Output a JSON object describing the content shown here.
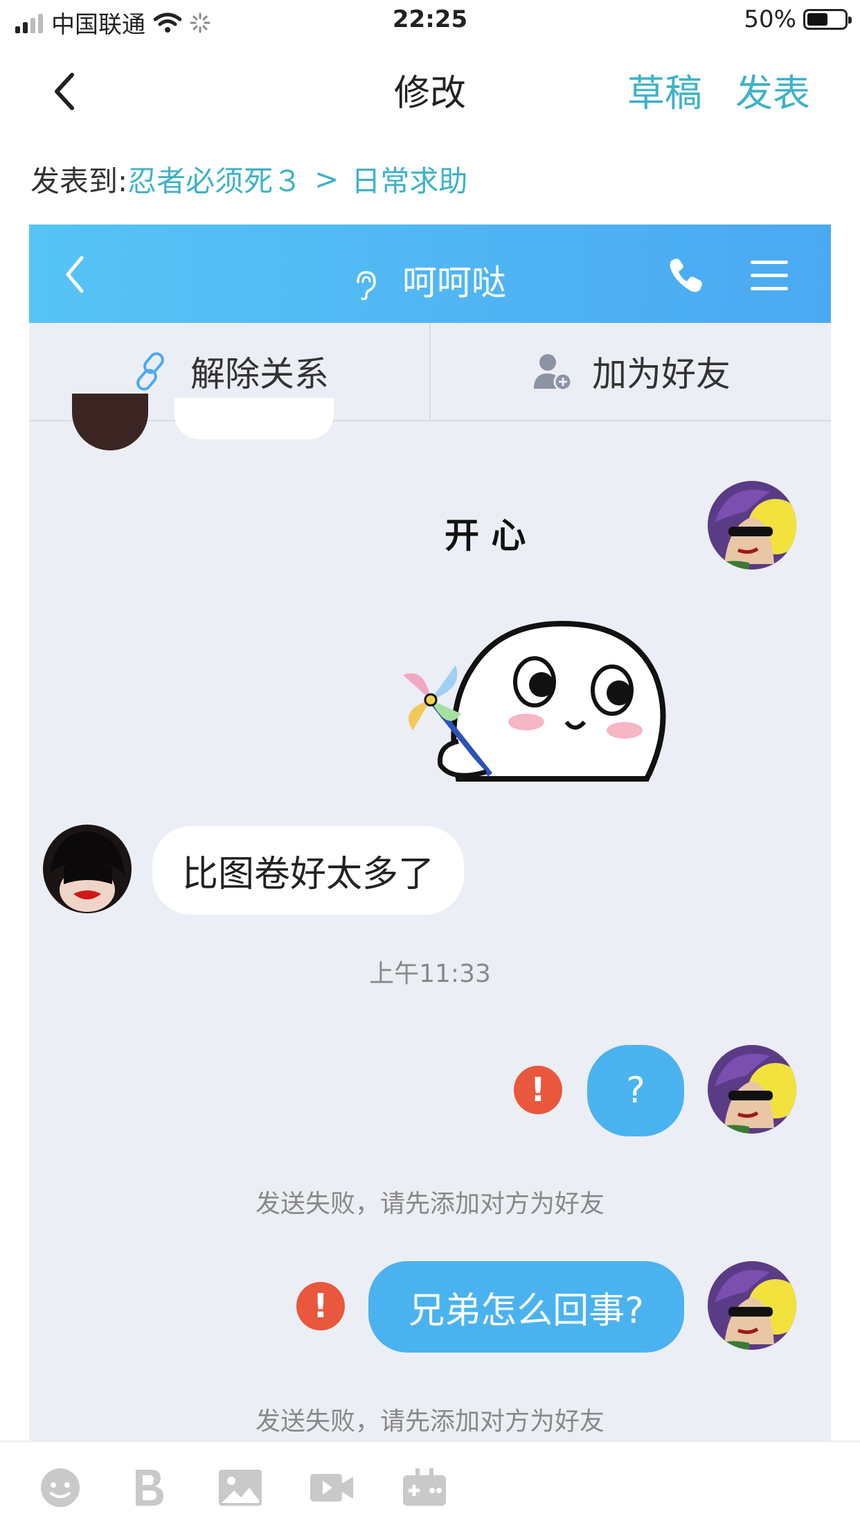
{
  "status_bar": {
    "carrier": "中国联通",
    "time": "22:25",
    "battery": "50%"
  },
  "nav": {
    "title": "修改",
    "draft_label": "草稿",
    "publish_label": "发表"
  },
  "post_to": {
    "label": "发表到:",
    "forum": "忍者必须死３",
    "separator": ">",
    "board": "日常求助"
  },
  "chat": {
    "contact_name": "呵呵哒",
    "actions": [
      {
        "label": "解除关系",
        "icon": "unlink-icon"
      },
      {
        "label": "加为好友",
        "icon": "add-friend-icon"
      }
    ],
    "sticker_caption": "开 心",
    "messages": [
      {
        "side": "left",
        "text": "比图卷好太多了"
      },
      {
        "side": "right",
        "text": "?",
        "failed": true
      },
      {
        "side": "right",
        "text": "兄弟怎么回事?",
        "failed": true
      }
    ],
    "timestamp": "上午11:33",
    "fail_note": "发送失败，请先添加对方为好友",
    "error_mark": "!"
  },
  "toolbar": {
    "icons": [
      "emoji-icon",
      "bold-icon",
      "image-icon",
      "video-icon",
      "game-icon"
    ]
  },
  "colors": {
    "accent": "#3fb2c7",
    "qq_blue": "#4aa9f2",
    "bubble_blue": "#4ab3ef",
    "error": "#e9573d",
    "chat_bg": "#eceef5"
  }
}
